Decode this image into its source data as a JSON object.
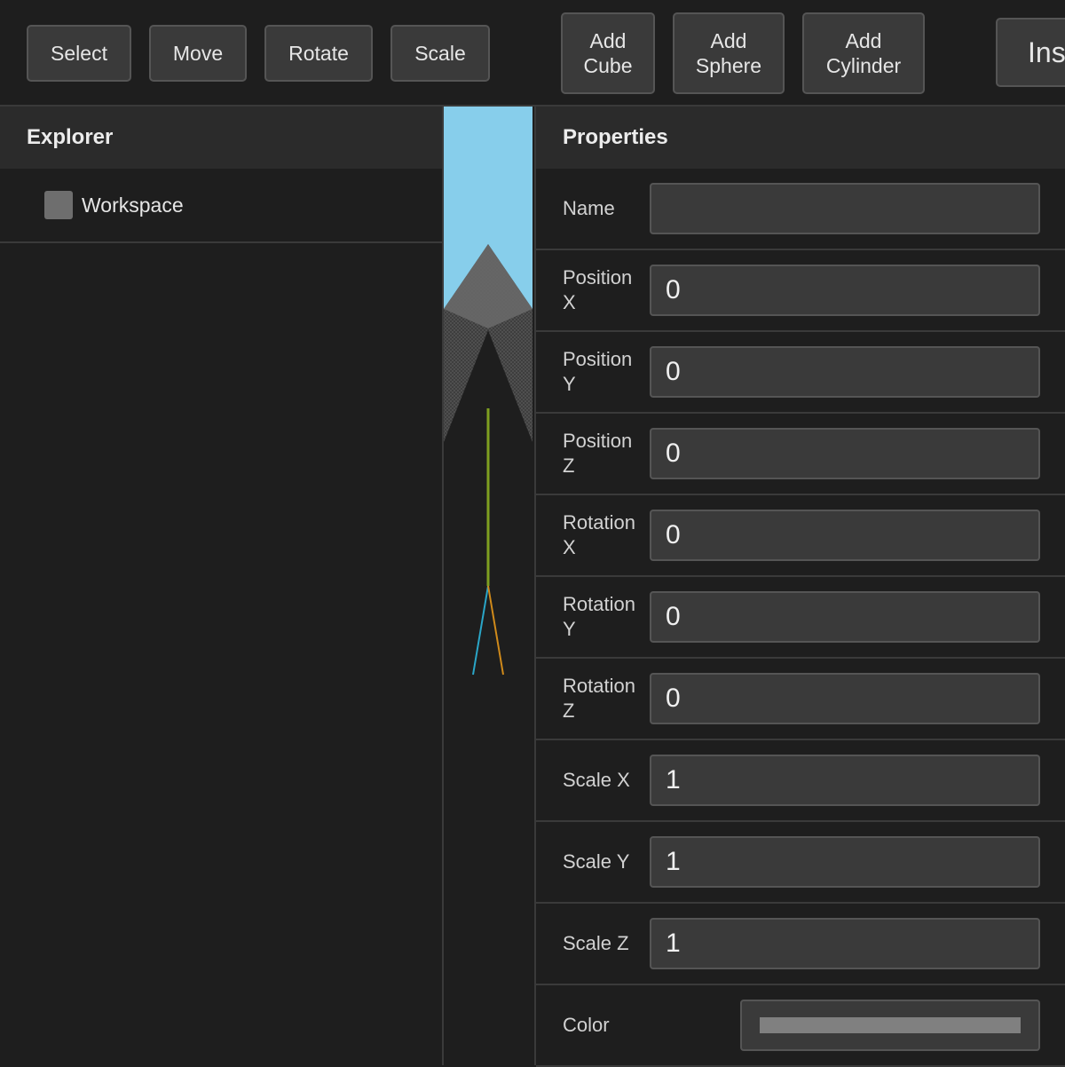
{
  "toolbar": {
    "select": "Select",
    "move": "Move",
    "rotate": "Rotate",
    "scale": "Scale",
    "add_cube": "Add\nCube",
    "add_sphere": "Add\nSphere",
    "add_cylinder": "Add\nCylinder",
    "insert": "Ins"
  },
  "explorer": {
    "title": "Explorer",
    "items": [
      {
        "label": "Workspace",
        "icon": "workspace-icon"
      }
    ]
  },
  "viewport": {
    "sky_color": "#87ceeb",
    "terrain_color": "#6b6b6b"
  },
  "properties": {
    "title": "Properties",
    "name_label": "Name",
    "name_value": "",
    "fields": [
      {
        "label": "Position\nX",
        "value": "0"
      },
      {
        "label": "Position\nY",
        "value": "0"
      },
      {
        "label": "Position\nZ",
        "value": "0"
      },
      {
        "label": "Rotation\nX",
        "value": "0"
      },
      {
        "label": "Rotation\nY",
        "value": "0"
      },
      {
        "label": "Rotation\nZ",
        "value": "0"
      },
      {
        "label": "Scale X",
        "value": "1"
      },
      {
        "label": "Scale Y",
        "value": "1"
      },
      {
        "label": "Scale Z",
        "value": "1"
      }
    ],
    "color_label": "Color",
    "color_value": "#808080"
  }
}
